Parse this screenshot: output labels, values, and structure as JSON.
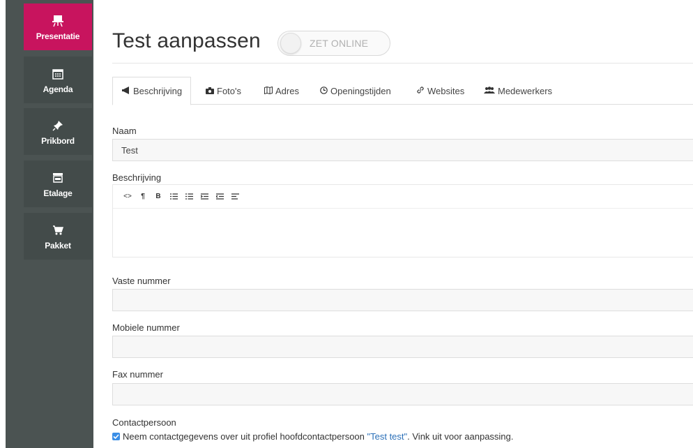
{
  "sidebar": {
    "items": [
      {
        "label": "Presentatie",
        "icon": "easel-icon",
        "active": true
      },
      {
        "label": "Agenda",
        "icon": "calendar-icon",
        "active": false
      },
      {
        "label": "Prikbord",
        "icon": "pin-icon",
        "active": false
      },
      {
        "label": "Etalage",
        "icon": "store-icon",
        "active": false
      },
      {
        "label": "Pakket",
        "icon": "cart-icon",
        "active": false
      }
    ]
  },
  "header": {
    "title": "Test aanpassen",
    "toggle_label": "ZET ONLINE"
  },
  "tabs": [
    {
      "label": "Beschrijving",
      "icon": "megaphone-icon"
    },
    {
      "label": "Foto's",
      "icon": "camera-icon"
    },
    {
      "label": "Adres",
      "icon": "map-icon"
    },
    {
      "label": "Openingstijden",
      "icon": "clock-icon"
    },
    {
      "label": "Websites",
      "icon": "link-icon"
    },
    {
      "label": "Medewerkers",
      "icon": "users-icon"
    }
  ],
  "form": {
    "naam_label": "Naam",
    "naam_value": "Test",
    "beschrijving_label": "Beschrijving",
    "toolbar": [
      "<>",
      "¶",
      "B",
      "ordered-list-icon",
      "unordered-list-icon",
      "outdent-icon",
      "indent-icon",
      "align-left-icon"
    ],
    "vaste_label": "Vaste nummer",
    "vaste_value": "",
    "mobiele_label": "Mobiele nummer",
    "mobiele_value": "",
    "fax_label": "Fax nummer",
    "fax_value": "",
    "contact_label": "Contactpersoon",
    "contact_text_before": "Neem contactgegevens over uit profiel hoofdcontactpersoon ",
    "contact_link": "\"Test test\"",
    "contact_text_after": ". Vink uit voor aanpassing.",
    "contact_checked": true
  },
  "colors": {
    "accent": "#c8145e",
    "sidebar": "#4b5352",
    "sidebar_item": "#434b4a",
    "link": "#2a6fb8",
    "checkbox": "#3a8ee6"
  }
}
